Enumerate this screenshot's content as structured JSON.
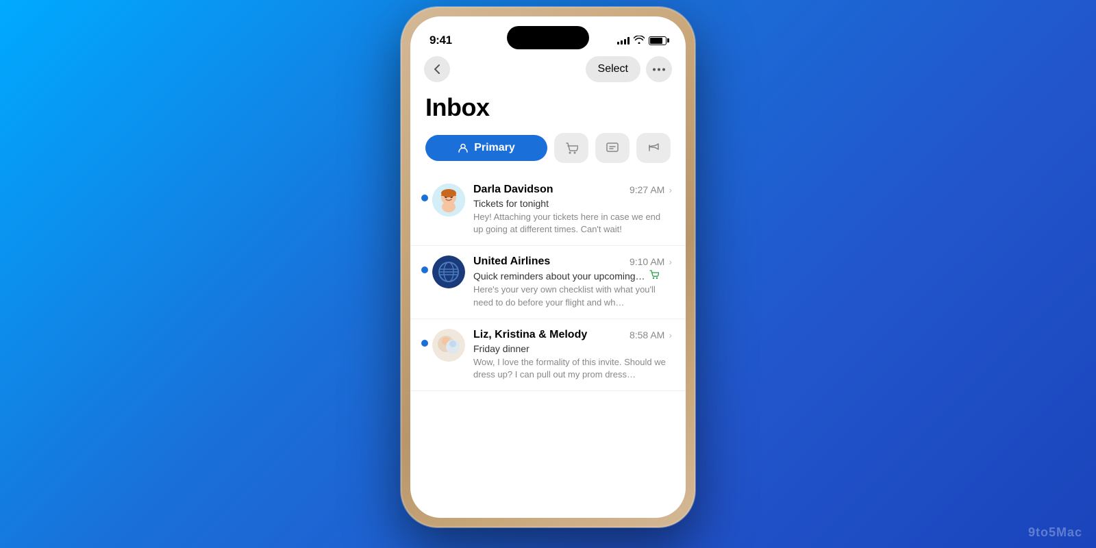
{
  "background": {
    "gradient_start": "#00aaff",
    "gradient_end": "#1a44bb"
  },
  "status_bar": {
    "time": "9:41",
    "signal_level": 4,
    "wifi": true,
    "battery_percent": 80
  },
  "nav_bar": {
    "back_label": "‹",
    "select_label": "Select",
    "more_label": "···"
  },
  "page_title": "Inbox",
  "category_tabs": [
    {
      "id": "primary",
      "label": "Primary",
      "active": true,
      "icon": "person"
    },
    {
      "id": "shopping",
      "label": "Shopping",
      "active": false,
      "icon": "cart"
    },
    {
      "id": "messages",
      "label": "Messages",
      "active": false,
      "icon": "chat"
    },
    {
      "id": "promos",
      "label": "Promotions",
      "active": false,
      "icon": "megaphone"
    }
  ],
  "emails": [
    {
      "id": "email-1",
      "sender": "Darla Davidson",
      "subject": "Tickets for tonight",
      "preview": "Hey! Attaching your tickets here in case we end up going at different times. Can't wait!",
      "time": "9:27 AM",
      "unread": true,
      "avatar_type": "emoji",
      "avatar_emoji": "🧒"
    },
    {
      "id": "email-2",
      "sender": "United Airlines",
      "subject": "Quick reminders about your upcoming…",
      "preview": "Here's your very own checklist with what you'll need to do before your flight and wh…",
      "time": "9:10 AM",
      "unread": true,
      "avatar_type": "logo",
      "has_cart_icon": true
    },
    {
      "id": "email-3",
      "sender": "Liz, Kristina & Melody",
      "subject": "Friday dinner",
      "preview": "Wow, I love the formality of this invite. Should we dress up? I can pull out my prom dress…",
      "time": "8:58 AM",
      "unread": true,
      "avatar_type": "group"
    }
  ],
  "watermark": "9to5Mac"
}
